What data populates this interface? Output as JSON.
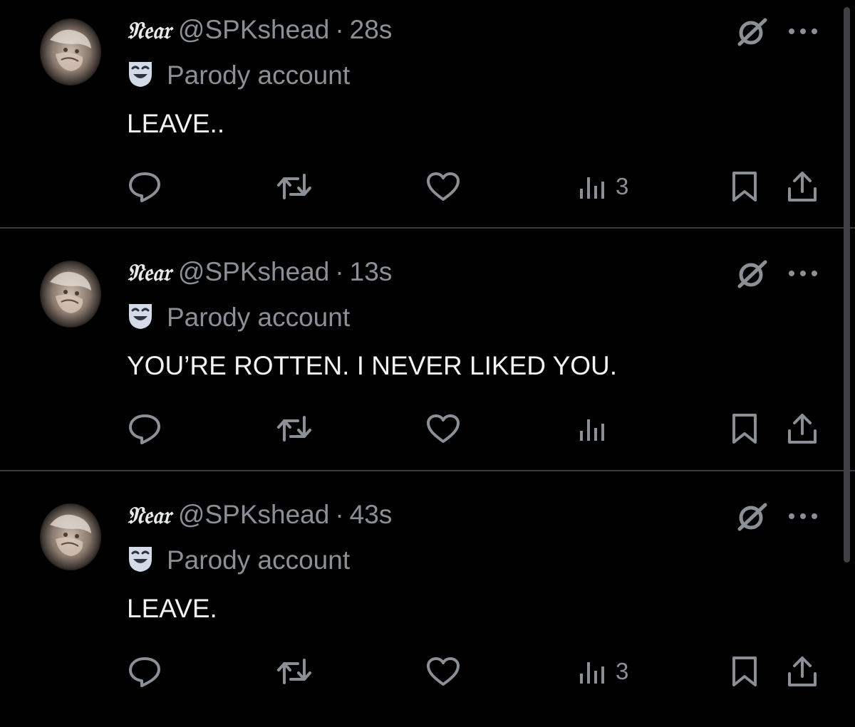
{
  "colors": {
    "background": "#000000",
    "text_primary": "#e7e9ea",
    "text_secondary": "#8b9096",
    "divider": "#3a3c40"
  },
  "icons": {
    "reply": "reply-icon",
    "retweet": "retweet-icon",
    "like": "heart-icon",
    "views": "views-icon",
    "bookmark": "bookmark-icon",
    "share": "share-icon",
    "grok": "grok-icon",
    "more": "more-icon",
    "parody_label": "parody-mask-icon"
  },
  "tweets": [
    {
      "display_name": "𝔑𝔢𝔞𝔯",
      "handle": "@SPKshead",
      "separator": "·",
      "time": "28s",
      "account_label": "Parody account",
      "text": "LEAVE..",
      "views_count": "3"
    },
    {
      "display_name": "𝔑𝔢𝔞𝔯",
      "handle": "@SPKshead",
      "separator": "·",
      "time": "13s",
      "account_label": "Parody account",
      "text": "YOU’RE ROTTEN. I NEVER LIKED YOU.",
      "views_count": ""
    },
    {
      "display_name": "𝔑𝔢𝔞𝔯",
      "handle": "@SPKshead",
      "separator": "·",
      "time": "43s",
      "account_label": "Parody account",
      "text": "LEAVE.",
      "views_count": "3"
    }
  ]
}
